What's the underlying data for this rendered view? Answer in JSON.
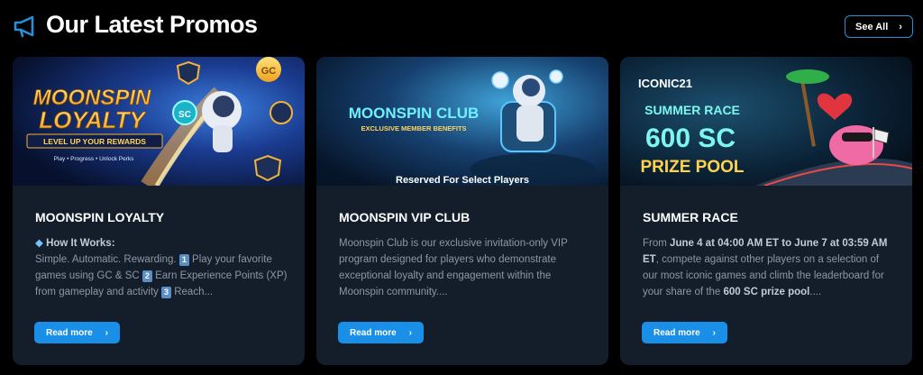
{
  "header": {
    "title": "Our Latest Promos",
    "see_all_label": "See All"
  },
  "colors": {
    "page_bg": "#000000",
    "card_bg": "#141e2b",
    "accent": "#1a8fe8",
    "muted_text": "#8d97a5"
  },
  "cards": [
    {
      "banner": {
        "line1": "MOONSPIN",
        "line2": "LOYALTY",
        "ribbon": "LEVEL UP YOUR REWARDS",
        "tagline": "Play • Progress • Unlock Perks",
        "badge_gc": "GC",
        "badge_sc": "SC"
      },
      "title": "MOONSPIN LOYALTY",
      "how_it_works": "How It Works:",
      "text_a": "Simple. Automatic. Rewarding.",
      "num1": "1",
      "text_b": "Play your favorite games using GC & SC",
      "num2": "2",
      "text_c": "Earn Experience Points (XP) from gameplay and activity",
      "num3": "3",
      "text_d": "Reach...",
      "read_more": "Read more"
    },
    {
      "banner": {
        "line1": "MOONSPIN CLUB",
        "line2": "EXCLUSIVE MEMBER BENEFITS",
        "caption": "Reserved For Select Players"
      },
      "title": "MOONSPIN VIP CLUB",
      "text": "Moonspin Club is our exclusive invitation-only VIP program designed for players who demonstrate exceptional loyalty and engagement within the Moonspin community....",
      "read_more": "Read more"
    },
    {
      "banner": {
        "brand": "ICONIC21",
        "line1": "SUMMER RACE",
        "line2": "600 SC",
        "line3": "PRIZE POOL"
      },
      "title": "SUMMER RACE",
      "text_a": "From",
      "text_bold1": "June 4 at 04:00 AM ET to June 7 at 03:59 AM ET",
      "text_b": ", compete against other players on a selection of our most iconic games and climb the leaderboard for your share of the",
      "text_bold2": "600 SC prize pool",
      "text_c": "....",
      "read_more": "Read more"
    }
  ]
}
